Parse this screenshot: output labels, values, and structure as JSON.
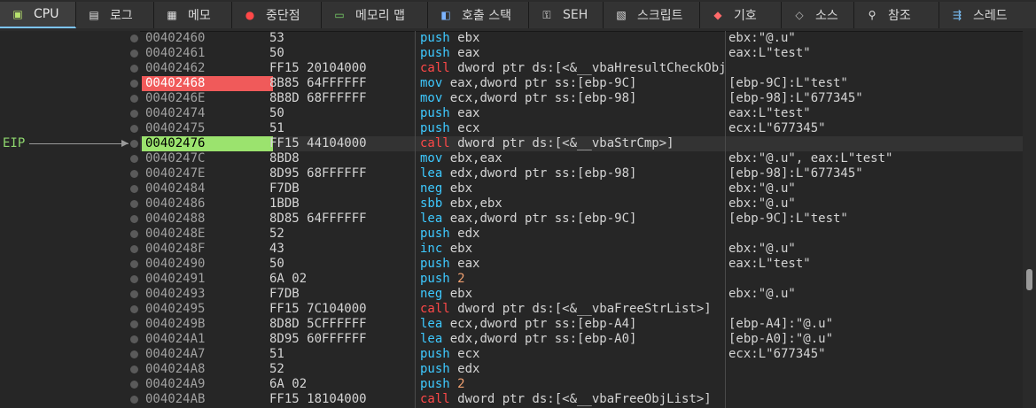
{
  "tabs": [
    {
      "label": "CPU",
      "icon": "cpu-icon",
      "active": true
    },
    {
      "label": "로그",
      "icon": "log-icon"
    },
    {
      "label": "메모",
      "icon": "notes-icon"
    },
    {
      "label": "중단점",
      "icon": "breakpoint-icon"
    },
    {
      "label": "메모리 맵",
      "icon": "memory-map-icon"
    },
    {
      "label": "호출 스택",
      "icon": "call-stack-icon"
    },
    {
      "label": "SEH",
      "icon": "seh-icon"
    },
    {
      "label": "스크립트",
      "icon": "script-icon"
    },
    {
      "label": "기호",
      "icon": "symbols-icon"
    },
    {
      "label": "소스",
      "icon": "source-icon"
    },
    {
      "label": "참조",
      "icon": "references-icon"
    },
    {
      "label": "스레드",
      "icon": "threads-icon"
    }
  ],
  "eip_label": "EIP",
  "colors": {
    "breakpoint": "#f05a5a",
    "eip": "#9be36e",
    "mnemonic": "#3ec9ff",
    "call": "#ff4848",
    "number": "#f0a070"
  },
  "rows": [
    {
      "addr": "00402460",
      "bytes": "53",
      "mn": "push",
      "ops": " ebx",
      "cmt": "ebx:\"@.u\"",
      "cls": "c-push"
    },
    {
      "addr": "00402461",
      "bytes": "50",
      "mn": "push",
      "ops": " eax",
      "cmt": "eax:L\"test\"",
      "cls": "c-push"
    },
    {
      "addr": "00402462",
      "bytes": "FF15 20104000",
      "mn": "call",
      "ops": " dword ptr ds:[<&__vbaHresultCheckObj>]",
      "cmt": "",
      "cls": "c-call"
    },
    {
      "addr": "00402468",
      "bytes": "8B85 64FFFFFF",
      "mn": "mov",
      "ops": " eax,dword ptr ss:[ebp-9C]",
      "cmt": "[ebp-9C]:L\"test\"",
      "cls": "c-mov",
      "bp": true
    },
    {
      "addr": "0040246E",
      "bytes": "8B8D 68FFFFFF",
      "mn": "mov",
      "ops": " ecx,dword ptr ss:[ebp-98]",
      "cmt": "[ebp-98]:L\"677345\"",
      "cls": "c-mov"
    },
    {
      "addr": "00402474",
      "bytes": "50",
      "mn": "push",
      "ops": " eax",
      "cmt": "eax:L\"test\"",
      "cls": "c-push"
    },
    {
      "addr": "00402475",
      "bytes": "51",
      "mn": "push",
      "ops": " ecx",
      "cmt": "ecx:L\"677345\"",
      "cls": "c-push"
    },
    {
      "addr": "00402476",
      "bytes": "FF15 44104000",
      "mn": "call",
      "ops": " dword ptr ds:[<&__vbaStrCmp>]",
      "cmt": "",
      "cls": "c-call",
      "ip": true
    },
    {
      "addr": "0040247C",
      "bytes": "8BD8",
      "mn": "mov",
      "ops": " ebx,eax",
      "cmt": "ebx:\"@.u\", eax:L\"test\"",
      "cls": "c-mov"
    },
    {
      "addr": "0040247E",
      "bytes": "8D95 68FFFFFF",
      "mn": "lea",
      "ops": " edx,dword ptr ss:[ebp-98]",
      "cmt": "[ebp-98]:L\"677345\"",
      "cls": "c-mov"
    },
    {
      "addr": "00402484",
      "bytes": "F7DB",
      "mn": "neg",
      "ops": " ebx",
      "cmt": "ebx:\"@.u\"",
      "cls": "c-mov"
    },
    {
      "addr": "00402486",
      "bytes": "1BDB",
      "mn": "sbb",
      "ops": " ebx,ebx",
      "cmt": "ebx:\"@.u\"",
      "cls": "c-mov"
    },
    {
      "addr": "00402488",
      "bytes": "8D85 64FFFFFF",
      "mn": "lea",
      "ops": " eax,dword ptr ss:[ebp-9C]",
      "cmt": "[ebp-9C]:L\"test\"",
      "cls": "c-mov"
    },
    {
      "addr": "0040248E",
      "bytes": "52",
      "mn": "push",
      "ops": " edx",
      "cmt": "",
      "cls": "c-push"
    },
    {
      "addr": "0040248F",
      "bytes": "43",
      "mn": "inc",
      "ops": " ebx",
      "cmt": "ebx:\"@.u\"",
      "cls": "c-mov"
    },
    {
      "addr": "00402490",
      "bytes": "50",
      "mn": "push",
      "ops": " eax",
      "cmt": "eax:L\"test\"",
      "cls": "c-push"
    },
    {
      "addr": "00402491",
      "bytes": "6A 02",
      "mn": "push",
      "ops": " 2",
      "cmt": "",
      "cls": "c-push",
      "num": true
    },
    {
      "addr": "00402493",
      "bytes": "F7DB",
      "mn": "neg",
      "ops": " ebx",
      "cmt": "ebx:\"@.u\"",
      "cls": "c-mov"
    },
    {
      "addr": "00402495",
      "bytes": "FF15 7C104000",
      "mn": "call",
      "ops": " dword ptr ds:[<&__vbaFreeStrList>]",
      "cmt": "",
      "cls": "c-call"
    },
    {
      "addr": "0040249B",
      "bytes": "8D8D 5CFFFFFF",
      "mn": "lea",
      "ops": " ecx,dword ptr ss:[ebp-A4]",
      "cmt": "[ebp-A4]:\"@.u\"",
      "cls": "c-mov"
    },
    {
      "addr": "004024A1",
      "bytes": "8D95 60FFFFFF",
      "mn": "lea",
      "ops": " edx,dword ptr ss:[ebp-A0]",
      "cmt": "[ebp-A0]:\"@.u\"",
      "cls": "c-mov"
    },
    {
      "addr": "004024A7",
      "bytes": "51",
      "mn": "push",
      "ops": " ecx",
      "cmt": "ecx:L\"677345\"",
      "cls": "c-push"
    },
    {
      "addr": "004024A8",
      "bytes": "52",
      "mn": "push",
      "ops": " edx",
      "cmt": "",
      "cls": "c-push"
    },
    {
      "addr": "004024A9",
      "bytes": "6A 02",
      "mn": "push",
      "ops": " 2",
      "cmt": "",
      "cls": "c-push",
      "num": true
    },
    {
      "addr": "004024AB",
      "bytes": "FF15 18104000",
      "mn": "call",
      "ops": " dword ptr ds:[<&__vbaFreeObjList>]",
      "cmt": "",
      "cls": "c-call"
    }
  ]
}
